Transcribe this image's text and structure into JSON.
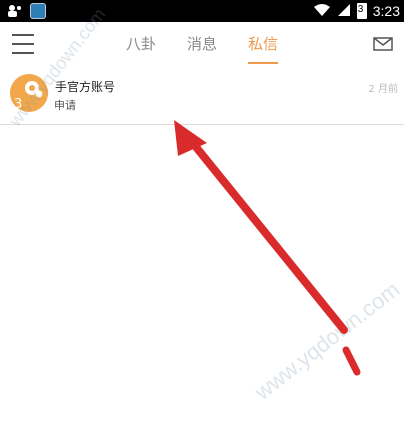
{
  "status_bar": {
    "time": "3:23",
    "battery_level": "3"
  },
  "header": {
    "tabs": [
      {
        "label": "八卦",
        "active": false
      },
      {
        "label": "消息",
        "active": false
      },
      {
        "label": "私信",
        "active": true
      }
    ],
    "accent_color": "#f09a4e"
  },
  "messages": [
    {
      "title": "手官方账号",
      "subtitle": "申请",
      "time": "2 月前",
      "avatar_text": "3"
    }
  ],
  "watermark": {
    "text1": "www.yqdown.com",
    "text2": "www.yqdown.com"
  },
  "annotation": {
    "arrow_color": "#d92b2b"
  }
}
